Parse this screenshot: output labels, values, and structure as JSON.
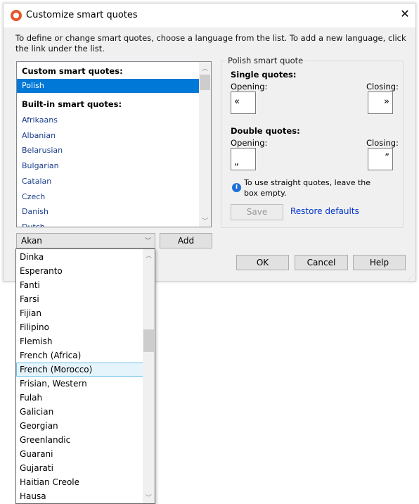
{
  "window": {
    "title": "Customize smart quotes",
    "close_icon": "close-icon"
  },
  "instructions": "To define or change smart quotes, choose a language from the list. To add a new language, click the link under the list.",
  "language_list": {
    "custom_header": "Custom smart quotes:",
    "custom_items": [
      "Polish"
    ],
    "selected": "Polish",
    "builtin_header": "Built-in smart quotes:",
    "builtin_items": [
      "Afrikaans",
      "Albanian",
      "Belarusian",
      "Bulgarian",
      "Catalan",
      "Czech",
      "Danish",
      "Dutch"
    ]
  },
  "group": {
    "title": "Polish smart quote",
    "single_label": "Single quotes:",
    "double_label": "Double quotes:",
    "opening_label": "Opening:",
    "closing_label": "Closing:",
    "single_opening": "«",
    "single_closing": "»",
    "double_opening": "„",
    "double_closing": "”",
    "info_text": "To use straight quotes, leave the box empty.",
    "save_label": "Save",
    "restore_label": "Restore defaults"
  },
  "add_combo": {
    "value": "Akan",
    "add_label": "Add"
  },
  "buttons": {
    "ok": "OK",
    "cancel": "Cancel",
    "help": "Help"
  },
  "dropdown": {
    "items": [
      "Dinka",
      "Esperanto",
      "Fanti",
      "Farsi",
      "Fijian",
      "Filipino",
      "Flemish",
      "French (Africa)",
      "French (Morocco)",
      "Frisian, Western",
      "Fulah",
      "Galician",
      "Georgian",
      "Greenlandic",
      "Guarani",
      "Gujarati",
      "Haitian Creole",
      "Hausa"
    ],
    "highlighted": "French (Morocco)"
  },
  "colors": {
    "selection": "#0078d7",
    "link": "#0033cc",
    "logo": "#e8552a"
  }
}
